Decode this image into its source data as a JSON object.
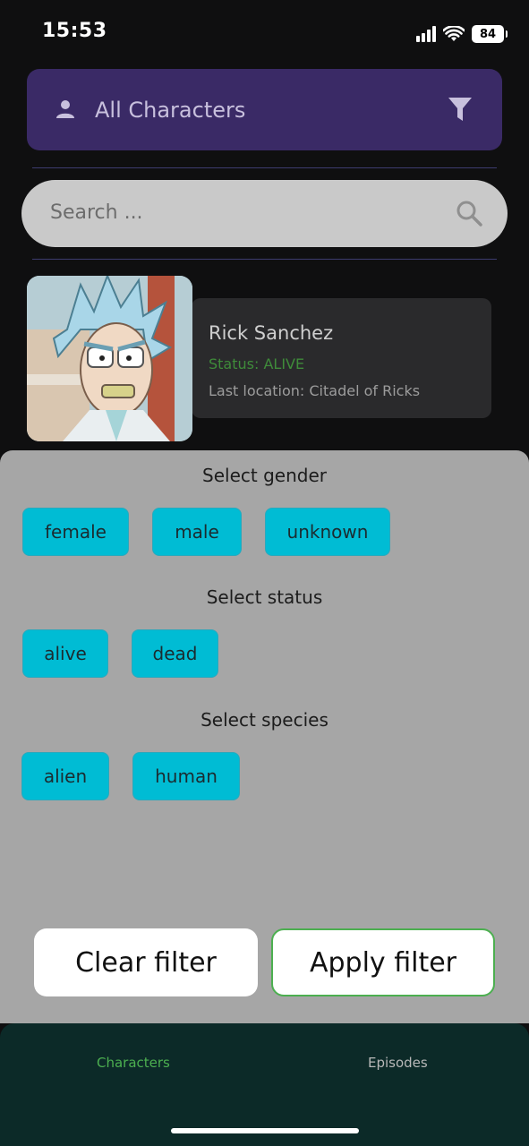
{
  "status_bar": {
    "time": "15:53",
    "battery": "84"
  },
  "header": {
    "title": "All Characters"
  },
  "search": {
    "placeholder": "Search ..."
  },
  "character": {
    "name": "Rick Sanchez",
    "status": "Status: ALIVE",
    "location": "Last location: Citadel of Ricks"
  },
  "filter_sheet": {
    "gender_title": "Select gender",
    "gender_options": [
      "female",
      "male",
      "unknown"
    ],
    "status_title": "Select status",
    "status_options": [
      "alive",
      "dead"
    ],
    "species_title": "Select species",
    "species_options": [
      "alien",
      "human"
    ],
    "clear_label": "Clear filter",
    "apply_label": "Apply filter"
  },
  "bottom_nav": {
    "characters": "Characters",
    "episodes": "Episodes"
  },
  "colors": {
    "accent": "#00bcd4",
    "header": "#3a2a66",
    "active_nav": "#4caf50"
  },
  "icons": {
    "header_left": "person-icon",
    "header_right": "filter-icon",
    "search": "search-icon"
  }
}
